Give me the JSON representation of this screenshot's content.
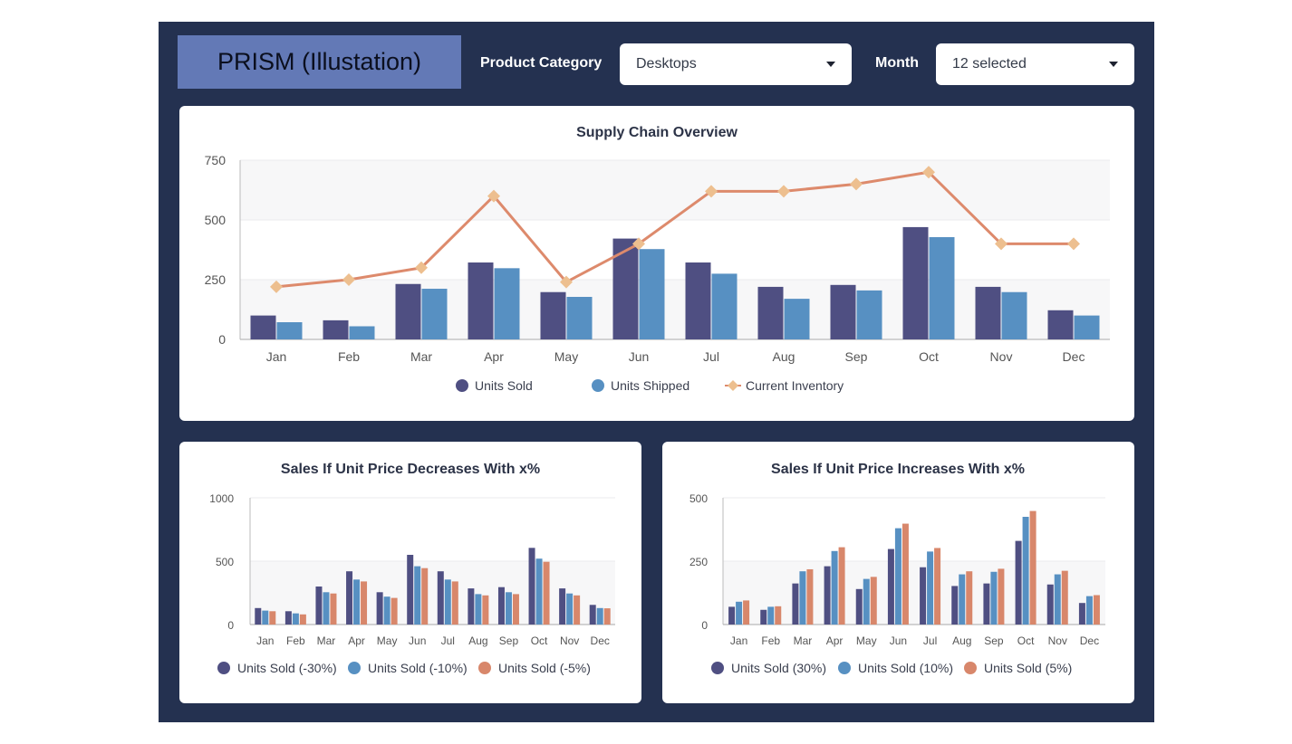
{
  "app": {
    "logo_text": "PRISM (Illustation)"
  },
  "filters": {
    "product_category_label": "Product Category",
    "product_category_value": "Desktops",
    "month_label": "Month",
    "month_value": "12 selected"
  },
  "colors": {
    "background": "#243150",
    "logo": "#6379b6",
    "units_sold": "#4f4f82",
    "units_shipped": "#5790c2",
    "inventory": "#dd8a6c",
    "inventory_marker": "#edbf8f",
    "pct_small": "#d8876b"
  },
  "icons": {
    "dropdown": "caret-down-icon"
  },
  "chart_data": [
    {
      "type": "bar",
      "title": "Supply Chain Overview",
      "categories": [
        "Jan",
        "Feb",
        "Mar",
        "Apr",
        "May",
        "Jun",
        "Jul",
        "Aug",
        "Sep",
        "Oct",
        "Nov",
        "Dec"
      ],
      "ylim": [
        0,
        750
      ],
      "yticks": [
        "0",
        "250",
        "500",
        "750"
      ],
      "grid": true,
      "legend_position": "bottom",
      "series": [
        {
          "name": "Units Sold",
          "type": "bar",
          "values": [
            100,
            80,
            232,
            322,
            198,
            422,
            322,
            220,
            228,
            470,
            220,
            122
          ]
        },
        {
          "name": "Units Shipped",
          "type": "bar",
          "values": [
            72,
            55,
            212,
            298,
            178,
            378,
            275,
            170,
            205,
            428,
            198,
            100
          ]
        },
        {
          "name": "Current Inventory",
          "type": "line",
          "values": [
            220,
            250,
            300,
            600,
            240,
            400,
            620,
            620,
            650,
            700,
            400,
            400
          ]
        }
      ]
    },
    {
      "type": "bar",
      "title": "Sales If Unit Price Decreases With x%",
      "categories": [
        "Jan",
        "Feb",
        "Mar",
        "Apr",
        "May",
        "Jun",
        "Jul",
        "Aug",
        "Sep",
        "Oct",
        "Nov",
        "Dec"
      ],
      "ylim": [
        0,
        1000
      ],
      "yticks": [
        "0",
        "500",
        "1000"
      ],
      "grid": true,
      "legend_position": "bottom",
      "series": [
        {
          "name": "Units Sold (-30%)",
          "values": [
            130,
            105,
            300,
            420,
            255,
            550,
            420,
            285,
            295,
            605,
            285,
            155
          ]
        },
        {
          "name": "Units Sold (-10%)",
          "values": [
            110,
            88,
            255,
            355,
            220,
            460,
            355,
            240,
            255,
            520,
            245,
            130
          ]
        },
        {
          "name": "Units Sold (-5%)",
          "values": [
            105,
            80,
            245,
            340,
            210,
            445,
            340,
            230,
            240,
            495,
            230,
            128
          ]
        }
      ]
    },
    {
      "type": "bar",
      "title": "Sales If Unit Price Increases With x%",
      "categories": [
        "Jan",
        "Feb",
        "Mar",
        "Apr",
        "May",
        "Jun",
        "Jul",
        "Aug",
        "Sep",
        "Oct",
        "Nov",
        "Dec"
      ],
      "ylim": [
        0,
        500
      ],
      "yticks": [
        "0",
        "250",
        "500"
      ],
      "grid": true,
      "legend_position": "bottom",
      "series": [
        {
          "name": "Units Sold (30%)",
          "values": [
            70,
            58,
            162,
            230,
            140,
            298,
            226,
            152,
            162,
            330,
            158,
            85
          ]
        },
        {
          "name": "Units Sold (10%)",
          "values": [
            90,
            70,
            210,
            290,
            180,
            380,
            288,
            198,
            208,
            425,
            198,
            112
          ]
        },
        {
          "name": "Units Sold (5%)",
          "values": [
            95,
            72,
            218,
            305,
            188,
            398,
            302,
            210,
            220,
            448,
            212,
            116
          ]
        }
      ]
    }
  ]
}
